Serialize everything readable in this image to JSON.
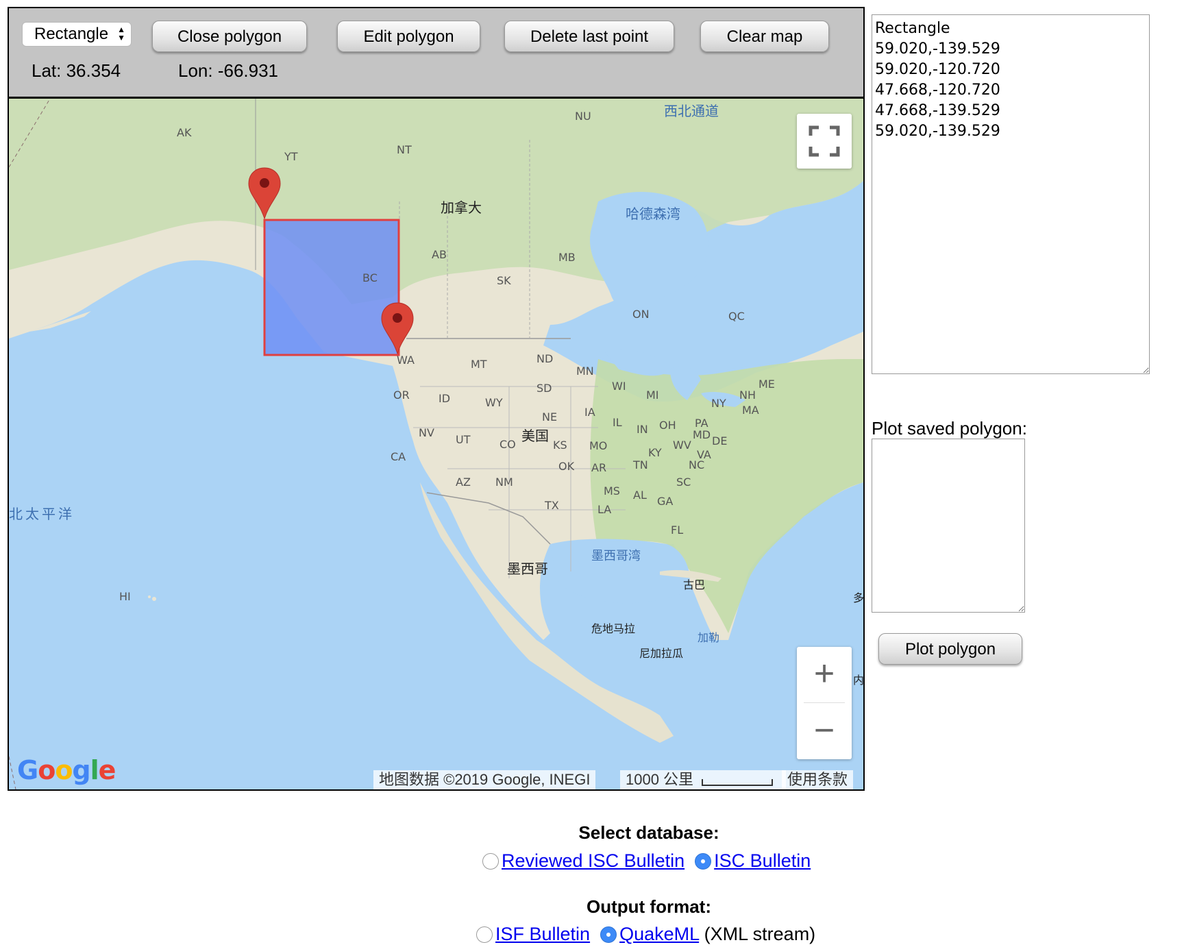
{
  "toolbar": {
    "shape_select": "Rectangle",
    "close_polygon": "Close polygon",
    "edit_polygon": "Edit polygon",
    "delete_last_point": "Delete last point",
    "clear_map": "Clear map",
    "lat": "Lat: 36.354",
    "lon": "Lon: -66.931"
  },
  "map": {
    "labels": {
      "ak": "AK",
      "yt": "YT",
      "nt": "NT",
      "nu": "NU",
      "northwest_passage": "西北通道",
      "canada": "加拿大",
      "hudson_bay": "哈德森湾",
      "ab": "AB",
      "bc": "BC",
      "mb": "MB",
      "sk": "SK",
      "on": "ON",
      "qc": "QC",
      "wa": "WA",
      "mt": "MT",
      "nd": "ND",
      "mn": "MN",
      "me": "ME",
      "or": "OR",
      "id": "ID",
      "sd": "SD",
      "wi": "WI",
      "mi": "MI",
      "ny": "NY",
      "nh": "NH",
      "ma": "MA",
      "wy": "WY",
      "ne": "NE",
      "ia": "IA",
      "il": "IL",
      "in": "IN",
      "oh": "OH",
      "pa": "PA",
      "md": "MD",
      "de": "DE",
      "nv": "NV",
      "ut": "UT",
      "co": "CO",
      "usa": "美国",
      "ks": "KS",
      "mo": "MO",
      "ky": "KY",
      "wv": "WV",
      "va": "VA",
      "ca": "CA",
      "az": "AZ",
      "nm": "NM",
      "ok": "OK",
      "ar": "AR",
      "tn": "TN",
      "nc": "NC",
      "ms": "MS",
      "al": "AL",
      "ga": "GA",
      "sc": "SC",
      "tx": "TX",
      "la": "LA",
      "fl": "FL",
      "north_pacific": "北太平洋",
      "gulf_of_mexico": "墨西哥湾",
      "mexico": "墨西哥",
      "cuba": "古巴",
      "hi": "HI",
      "guatemala": "危地马拉",
      "nicaragua": "尼加拉瓜",
      "caribbean": "加勒",
      "dominica": "多",
      "inner": "内"
    },
    "google_logo": "Google",
    "attribution": "地图数据 ©2019 Google, INEGI",
    "scale": "1000 公里",
    "terms": "使用条款",
    "zoom_in": "+",
    "zoom_out": "−",
    "colors": {
      "water": "#abd3f5",
      "land": "#e9e5d4",
      "forest": "#bcd6a8",
      "rectangle_fill": "#6f8ff5",
      "rectangle_stroke": "#e04040",
      "marker": "#db4437"
    }
  },
  "coords_text": "Rectangle\n59.020,-139.529\n59.020,-120.720\n47.668,-120.720\n47.668,-139.529\n59.020,-139.529",
  "saved": {
    "label": "Plot saved polygon:",
    "button": "Plot polygon",
    "value": ""
  },
  "database": {
    "title": "Select database:",
    "options": [
      {
        "label": "Reviewed ISC Bulletin",
        "selected": false
      },
      {
        "label": "ISC Bulletin",
        "selected": true
      }
    ]
  },
  "output": {
    "title": "Output format:",
    "options": [
      {
        "label": "ISF Bulletin",
        "selected": false
      },
      {
        "label": "QuakeML",
        "selected": true
      }
    ],
    "suffix": "(XML stream)"
  }
}
